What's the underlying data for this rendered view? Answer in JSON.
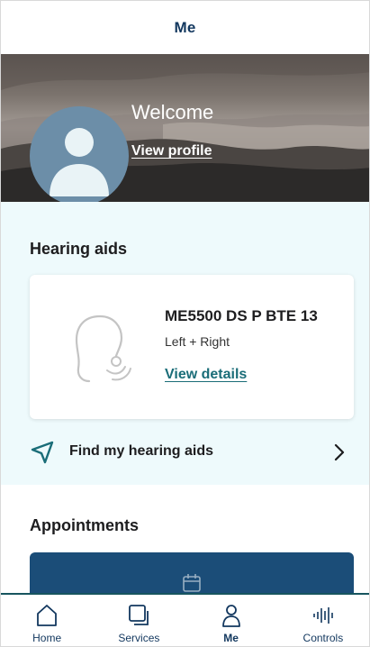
{
  "header": {
    "title": "Me"
  },
  "profile": {
    "greeting": "Welcome",
    "view_profile_label": "View profile"
  },
  "hearing_aids": {
    "section_title": "Hearing aids",
    "device": {
      "name": "ME5500 DS P BTE 13",
      "sides": "Left + Right",
      "view_details_label": "View details"
    },
    "find_label": "Find my hearing aids"
  },
  "appointments": {
    "section_title": "Appointments"
  },
  "bottom_nav": {
    "items": [
      {
        "label": "Home",
        "icon": "home-icon",
        "active": false
      },
      {
        "label": "Services",
        "icon": "services-icon",
        "active": false
      },
      {
        "label": "Me",
        "icon": "person-icon",
        "active": true
      },
      {
        "label": "Controls",
        "icon": "controls-icon",
        "active": false
      }
    ]
  },
  "colors": {
    "brand_navy": "#12375e",
    "accent_teal": "#1a6d78",
    "section_bg": "#eefafc",
    "appointment_card": "#1b4d78",
    "avatar_bg": "#6c8ea8"
  }
}
